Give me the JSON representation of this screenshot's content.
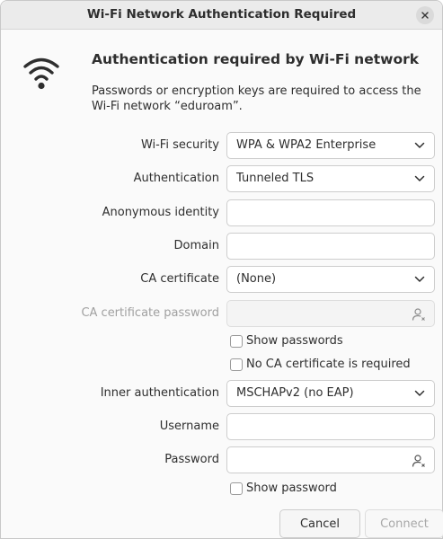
{
  "window": {
    "title": "Wi-Fi Network Authentication Required"
  },
  "header": {
    "heading": "Authentication required by Wi-Fi network",
    "description": "Passwords or encryption keys are required to access the Wi-Fi network “eduroam”."
  },
  "form": {
    "wifi_security": {
      "label": "Wi-Fi security",
      "value": "WPA & WPA2 Enterprise"
    },
    "authentication": {
      "label": "Authentication",
      "value": "Tunneled TLS"
    },
    "anonymous_identity": {
      "label": "Anonymous identity",
      "value": ""
    },
    "domain": {
      "label": "Domain",
      "value": ""
    },
    "ca_certificate": {
      "label": "CA certificate",
      "value": "(None)"
    },
    "ca_certificate_password": {
      "label": "CA certificate password",
      "value": ""
    },
    "show_passwords": {
      "label": "Show passwords",
      "checked": false
    },
    "no_ca_required": {
      "label": "No CA certificate is required",
      "checked": false
    },
    "inner_authentication": {
      "label": "Inner authentication",
      "value": "MSCHAPv2 (no EAP)"
    },
    "username": {
      "label": "Username",
      "value": ""
    },
    "password": {
      "label": "Password",
      "value": ""
    },
    "show_password": {
      "label": "Show password",
      "checked": false
    }
  },
  "buttons": {
    "cancel": "Cancel",
    "connect": "Connect"
  },
  "icons": {
    "wifi": "wifi-icon",
    "close": "close-icon",
    "chevron": "chevron-down-icon",
    "user": "user-icon"
  }
}
